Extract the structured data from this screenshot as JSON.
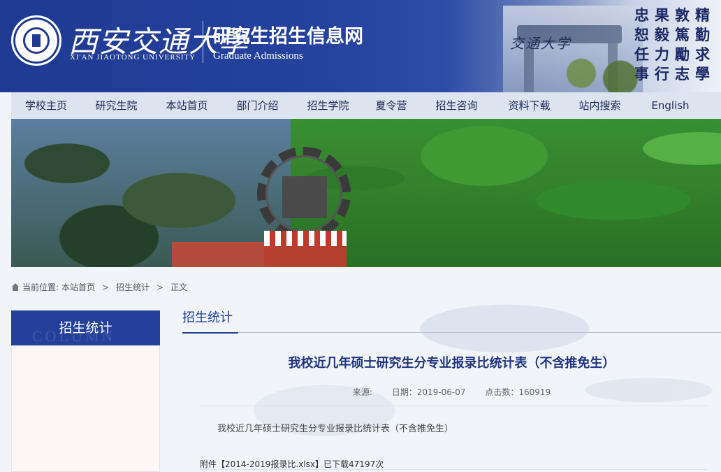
{
  "header": {
    "logo_cn": "西安交通大學",
    "logo_en": "XI'AN JIAOTONG UNIVERSITY",
    "site_title": "研究生招生信息网",
    "site_subtitle": "Graduate Admissions",
    "gate_text": "交通大学",
    "motto": [
      "忠",
      "果",
      "敦",
      "精",
      "恕",
      "毅",
      "篤",
      "勤",
      "任",
      "力",
      "勵",
      "求",
      "事",
      "行",
      "志",
      "學"
    ]
  },
  "nav": {
    "items": [
      {
        "label": "学校主页"
      },
      {
        "label": "研究生院"
      },
      {
        "label": "本站首页"
      },
      {
        "label": "部门介绍"
      },
      {
        "label": "招生学院"
      },
      {
        "label": "夏令营"
      },
      {
        "label": "招生咨询"
      },
      {
        "label": "资料下载"
      },
      {
        "label": "站内搜索"
      },
      {
        "label": "English"
      }
    ]
  },
  "breadcrumb": {
    "prefix": "当前位置:",
    "items": [
      "本站首页",
      "招生统计",
      "正文"
    ],
    "separator": ">"
  },
  "sidebar": {
    "title": "招生统计",
    "ghost": "COLUMN"
  },
  "content": {
    "section_tab": "招生统计",
    "article_title": "我校近几年硕士研究生分专业报录比统计表（不含推免生）",
    "meta": {
      "source": "来源:",
      "date": "日期：2019-06-07",
      "clicks": "点击数：160919"
    },
    "body": "我校近几年硕士研究生分专业报录比统计表（不含推免生）",
    "attachment": "附件【2014-2019报录比.xlsx】已下载47197次"
  },
  "colors": {
    "primary": "#24409a",
    "nav_bg": "#dde3ef",
    "title": "#1f3480"
  }
}
